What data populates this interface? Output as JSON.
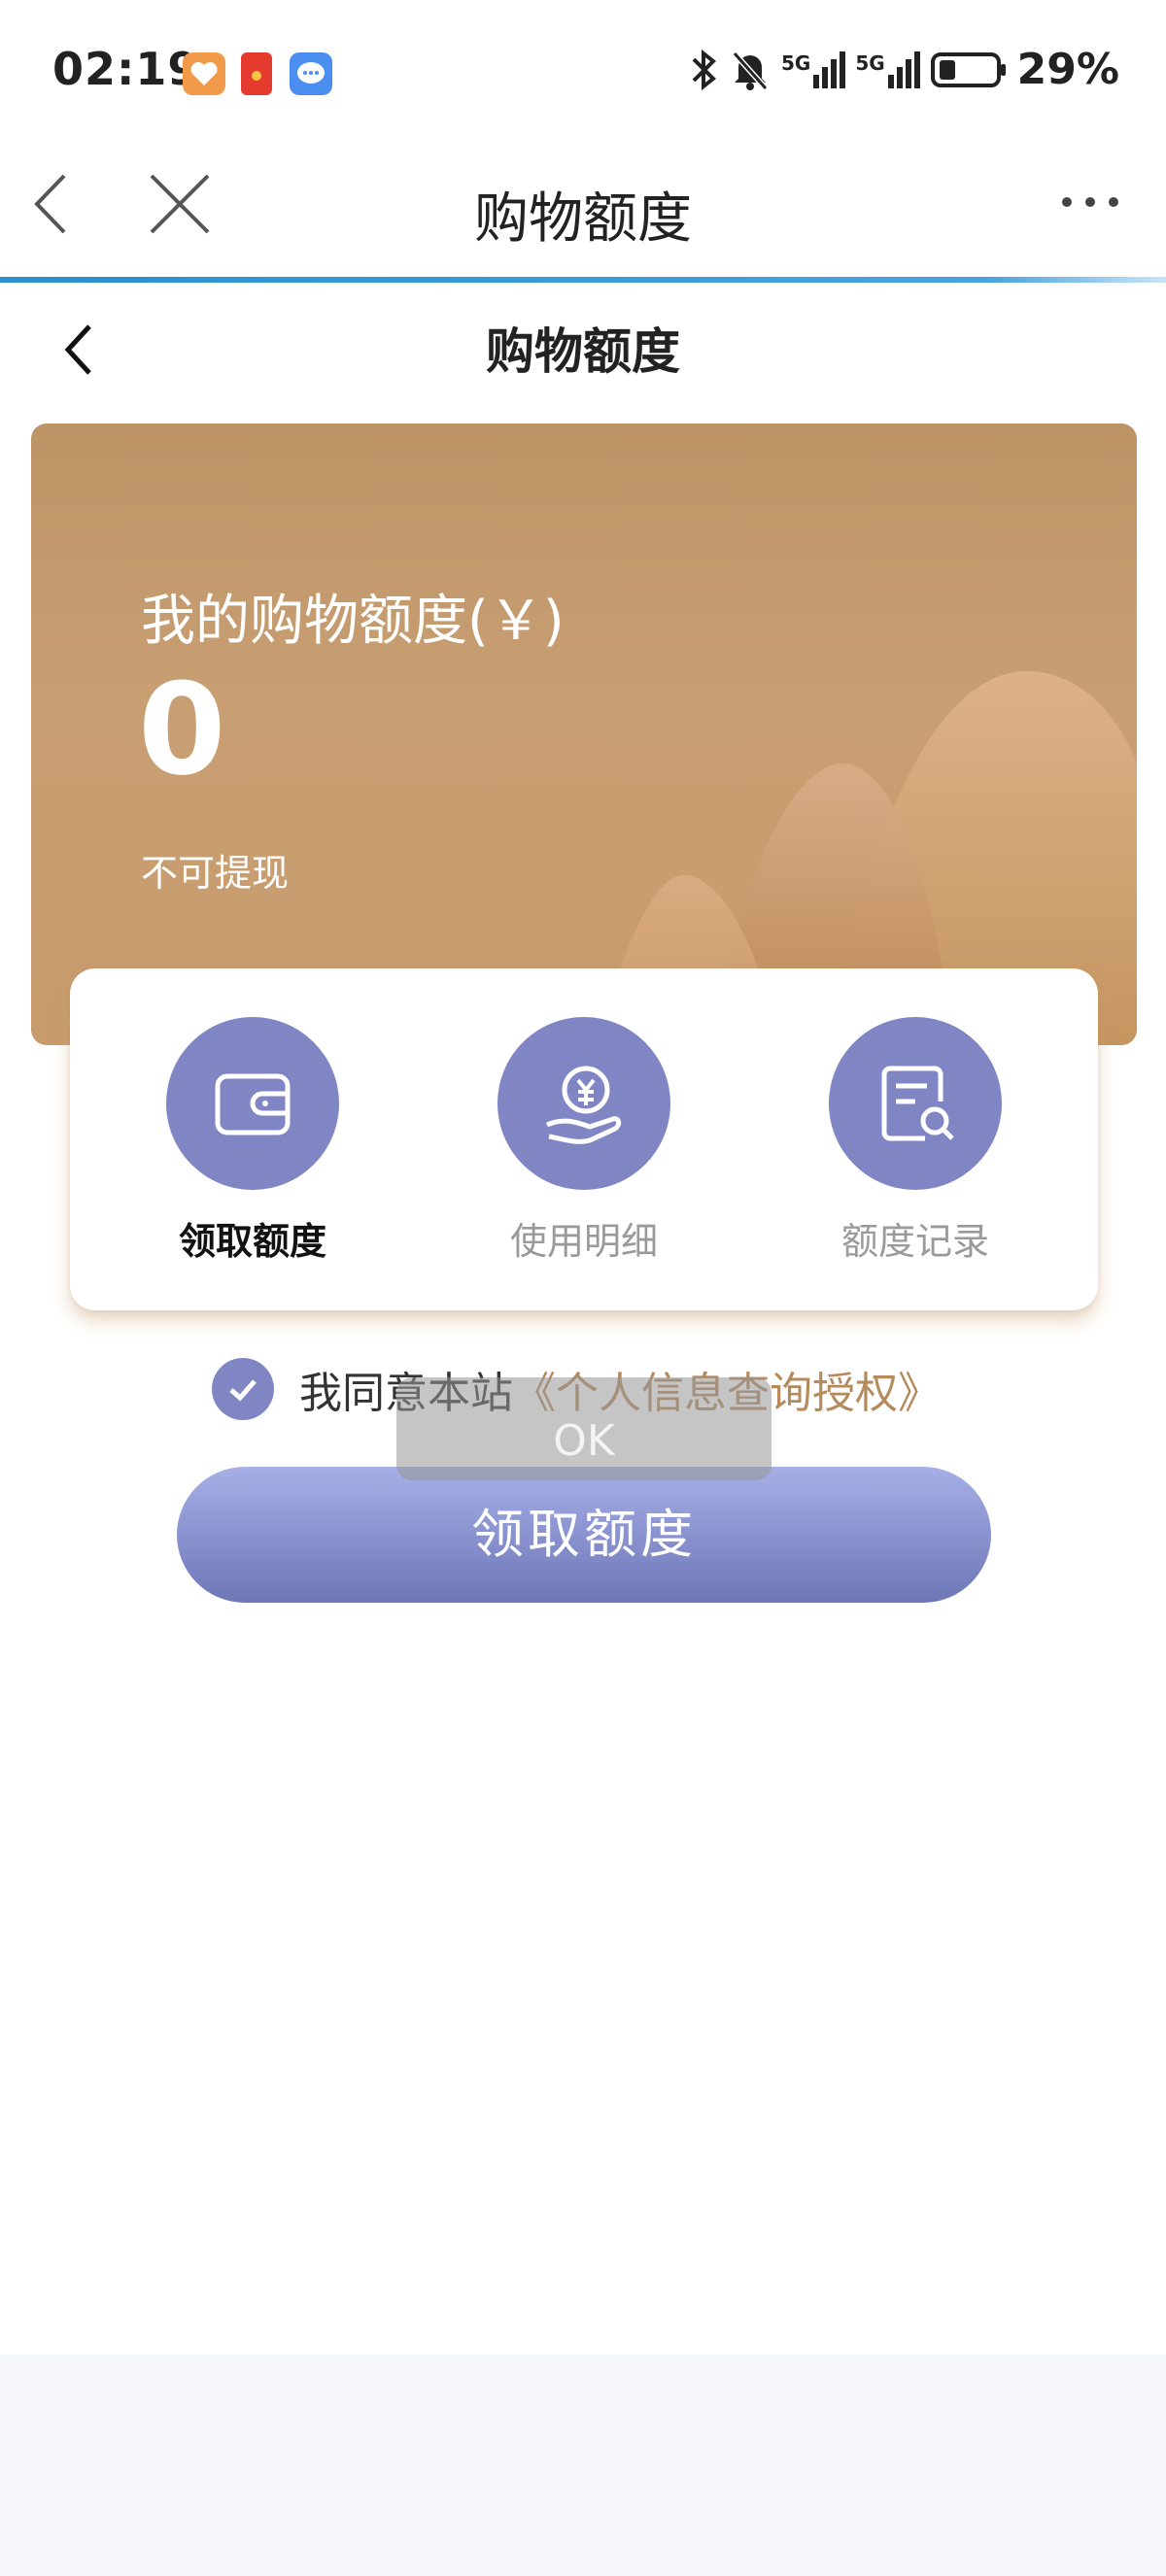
{
  "status_bar": {
    "time": "02:19",
    "battery": "29%",
    "network_1": "5G",
    "network_2": "5G"
  },
  "browser_nav": {
    "title": "购物额度"
  },
  "page": {
    "title": "购物额度"
  },
  "quota_card": {
    "label": "我的购物额度(￥)",
    "value": "0",
    "note": "不可提现"
  },
  "actions": [
    {
      "label": "领取额度",
      "icon": "wallet-icon",
      "active": true
    },
    {
      "label": "使用明细",
      "icon": "yuan-hand-icon",
      "active": false
    },
    {
      "label": "额度记录",
      "icon": "document-search-icon",
      "active": false
    }
  ],
  "agreement": {
    "prefix": "我同意本站",
    "link": "《个人信息查询授权》",
    "checked": true
  },
  "submit_button": {
    "label": "领取额度"
  },
  "toast": {
    "text": "OK"
  },
  "colors": {
    "accent": "#7f86c3",
    "card": "#c69b6d",
    "link": "#b58b5e",
    "nav_line": "#2a8fd0"
  }
}
